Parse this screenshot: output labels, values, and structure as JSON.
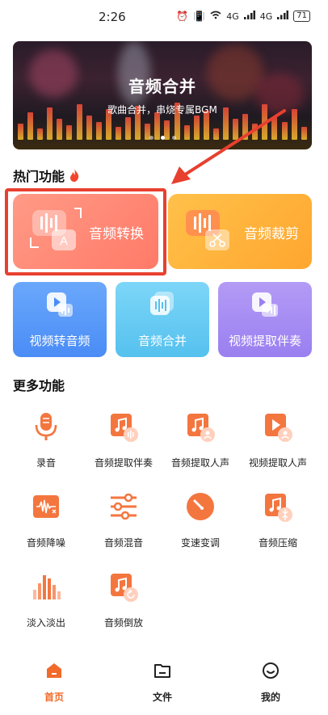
{
  "status_bar": {
    "time": "2:26",
    "battery": "71",
    "network": "4G",
    "network2": "4G"
  },
  "banner": {
    "title": "音频合并",
    "subtitle": "歌曲合并，串烧专属BGM",
    "pages": 3,
    "active_page": 2
  },
  "hot_section": {
    "title": "热门功能",
    "icon": "flame-icon"
  },
  "hot_cards": [
    {
      "label": "音频转换",
      "icon": "audio-convert-icon",
      "color": "#ff8d78"
    },
    {
      "label": "音频裁剪",
      "icon": "audio-cut-icon",
      "color": "#ffb53a"
    }
  ],
  "small_cards": [
    {
      "label": "视频转音频",
      "icon": "video-to-audio-icon",
      "color": "#5b9bf8"
    },
    {
      "label": "音频合并",
      "icon": "audio-merge-icon",
      "color": "#62c9f2"
    },
    {
      "label": "视频提取伴奏",
      "icon": "video-extract-accompaniment-icon",
      "color": "#a58af0"
    }
  ],
  "more_section": {
    "title": "更多功能"
  },
  "more_items": [
    {
      "label": "录音",
      "icon": "microphone-icon"
    },
    {
      "label": "音频提取伴奏",
      "icon": "audio-extract-accompaniment-icon"
    },
    {
      "label": "音频提取人声",
      "icon": "audio-extract-vocal-icon"
    },
    {
      "label": "视频提取人声",
      "icon": "video-extract-vocal-icon"
    },
    {
      "label": "音频降噪",
      "icon": "audio-denoise-icon"
    },
    {
      "label": "音频混音",
      "icon": "audio-mix-icon"
    },
    {
      "label": "变速变调",
      "icon": "speed-pitch-icon"
    },
    {
      "label": "音频压缩",
      "icon": "audio-compress-icon"
    },
    {
      "label": "淡入淡出",
      "icon": "fade-in-out-icon"
    },
    {
      "label": "音频倒放",
      "icon": "audio-reverse-icon"
    }
  ],
  "bottom_nav": [
    {
      "label": "首页",
      "icon": "home-icon",
      "active": true
    },
    {
      "label": "文件",
      "icon": "folder-icon",
      "active": false
    },
    {
      "label": "我的",
      "icon": "profile-icon",
      "active": false
    }
  ],
  "colors": {
    "accent": "#f06a2a",
    "icon_orange": "#f4763f",
    "annotation_red": "#e8402f"
  }
}
